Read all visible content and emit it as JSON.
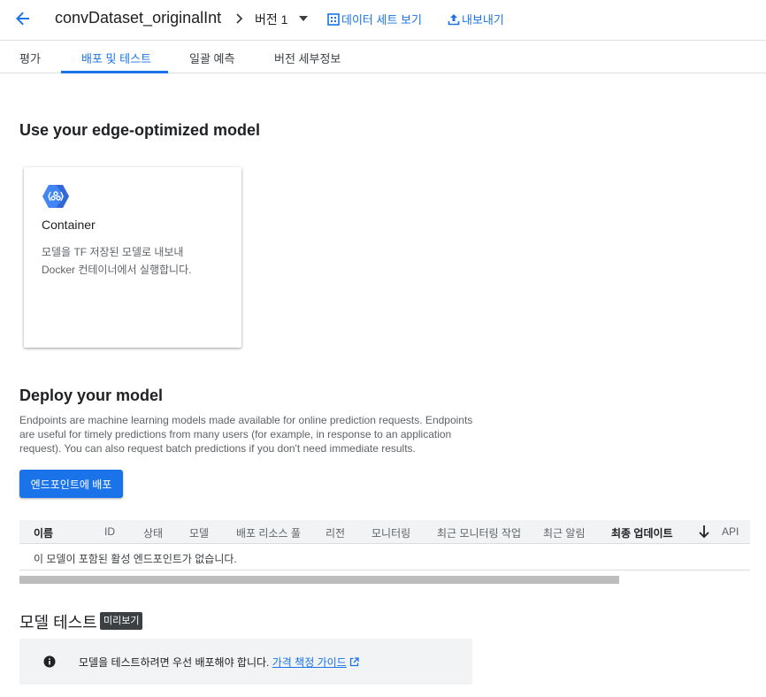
{
  "header": {
    "title": "convDataset_originalInt",
    "version_label": "버전 1",
    "view_dataset_label": "데이터 세트 보기",
    "export_label": "내보내기"
  },
  "tabs": [
    {
      "label": "평가"
    },
    {
      "label": "배포 및 테스트"
    },
    {
      "label": "일괄 예측"
    },
    {
      "label": "버전 세부정보"
    }
  ],
  "edge_section": {
    "title": "Use your edge-optimized model",
    "card": {
      "title": "Container",
      "desc_line1": "모델을 TF 저장된 모델로 내보내",
      "desc_line2": "Docker 컨테이너에서 실행합니다."
    }
  },
  "deploy_section": {
    "title": "Deploy your model",
    "desc_line1": "Endpoints are machine learning models made available for online prediction requests. Endpoints",
    "desc_line2": "are useful for timely predictions from many users (for example, in response to an application",
    "desc_line3": "request). You can also request batch predictions if you don't need immediate results.",
    "deploy_button": "엔드포인트에 배포",
    "table": {
      "columns": [
        "이름",
        "ID",
        "상태",
        "모델",
        "배포 리소스 풀",
        "리전",
        "모니터링",
        "최근 모니터링 작업",
        "최근 알림",
        "최종 업데이트",
        "API"
      ],
      "empty_text": "이 모델이 포함된 활성 엔드포인트가 없습니다."
    }
  },
  "test_section": {
    "title": "모델 테스트",
    "badge": "미리보기",
    "info_text": "모델을 테스트하려면 우선 배포해야 합니다.",
    "link_text": "가격 책정 가이드"
  },
  "colors": {
    "accent": "#1a73e8",
    "badge_bg": "#3c4043",
    "info_bg": "#f1f3f4"
  }
}
